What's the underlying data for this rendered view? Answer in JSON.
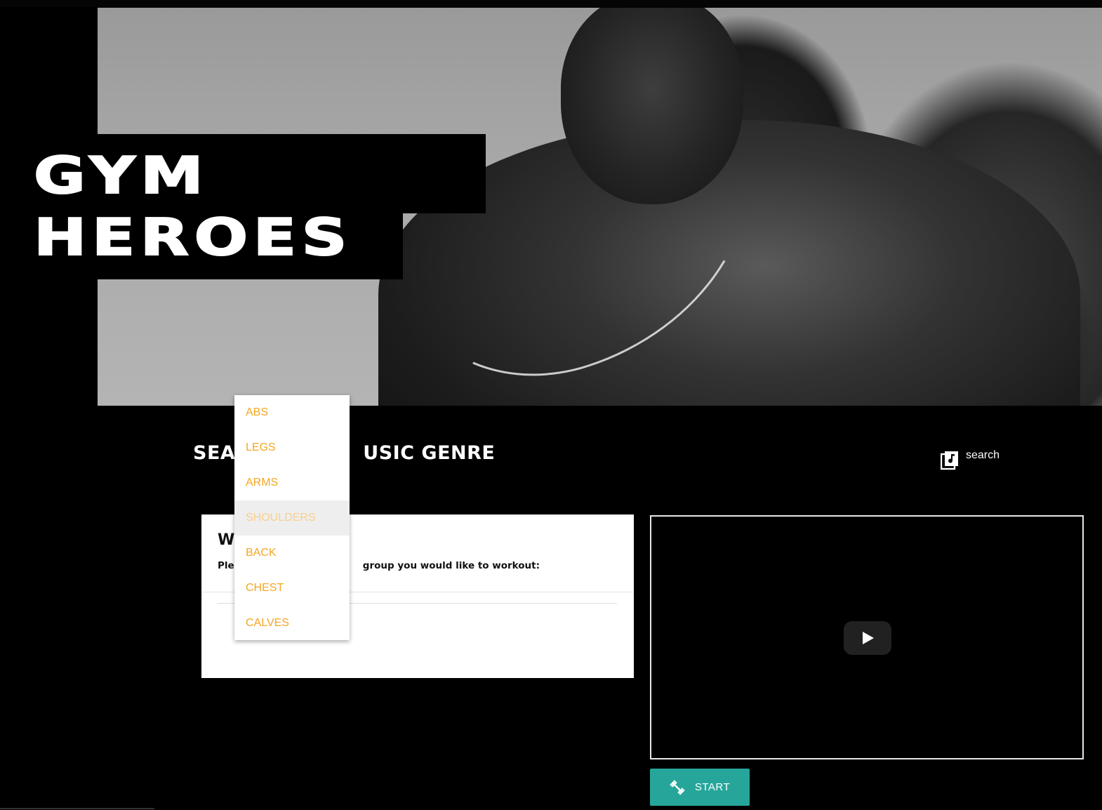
{
  "logo": {
    "line1": "GYM",
    "line2": "HEROES"
  },
  "search": {
    "heading_left": "SEA",
    "heading_right": "USIC GENRE",
    "link_label": "search",
    "link_icon": "music-library-icon"
  },
  "workout_card": {
    "title": "W",
    "subtitle_left": "Plea",
    "subtitle_right": "group you would like to workout:"
  },
  "muscle_menu": {
    "items": [
      {
        "label": "ABS"
      },
      {
        "label": "LEGS"
      },
      {
        "label": "ARMS"
      },
      {
        "label": "SHOULDERS"
      },
      {
        "label": "BACK"
      },
      {
        "label": "CHEST"
      },
      {
        "label": "CALVES"
      }
    ],
    "highlighted": "SHOULDERS",
    "item_color": "#f5a623"
  },
  "video": {
    "play_icon": "play-icon"
  },
  "start_button": {
    "label": "START",
    "icon": "dumbbell-icon",
    "color": "#26a69a"
  }
}
